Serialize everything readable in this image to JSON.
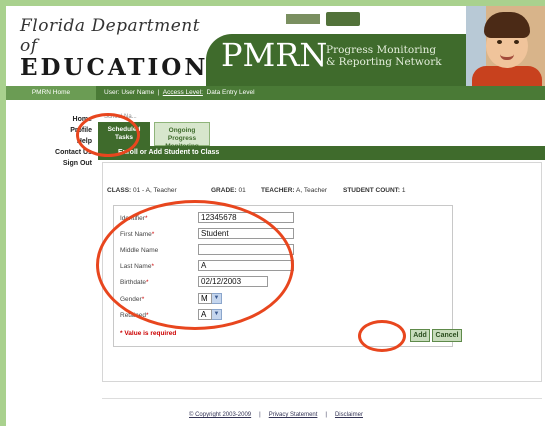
{
  "header": {
    "logo_script": "Florida Department of",
    "logo_main": "EDUCATION",
    "brand": "PMRN",
    "tagline_line1": "Progress Monitoring",
    "tagline_line2": "& Reporting Network"
  },
  "subbar": {
    "home_label": "PMRN Home",
    "user_prefix": "User:",
    "user_name": "User Name",
    "access_label": "Access Level:",
    "access_value": "Data Entry Level"
  },
  "nav": {
    "items": [
      {
        "label": "Home"
      },
      {
        "label": "Profile"
      },
      {
        "label": "Help"
      },
      {
        "label": "Contact Us"
      },
      {
        "label": "Sign Out"
      }
    ]
  },
  "main": {
    "breadcrumb": "School Na...",
    "tabs": [
      {
        "label_line1": "Scheduled",
        "label_line2": "Tasks"
      },
      {
        "label_line1": "Ongoing Progress",
        "label_line2": "Monitoring"
      }
    ],
    "section_title": "Enroll or Add Student to Class",
    "class_info": {
      "class_label": "CLASS:",
      "class_value": "01 - A, Teacher",
      "grade_label": "GRADE:",
      "grade_value": "01",
      "teacher_label": "TEACHER:",
      "teacher_value": "A, Teacher",
      "count_label": "STUDENT COUNT:",
      "count_value": "1"
    },
    "form": {
      "identifier_label": "Identifier",
      "identifier_value": "12345678",
      "first_name_label": "First Name",
      "first_name_value": "Student",
      "middle_name_label": "Middle Name",
      "middle_name_value": "",
      "last_name_label": "Last Name",
      "last_name_value": "A",
      "birthdate_label": "Birthdate",
      "birthdate_value": "02/12/2003",
      "gender_label": "Gender",
      "gender_value": "M",
      "retained_label": "Retained",
      "retained_value": "A",
      "required_marker": "*",
      "required_note": "* Value is required",
      "add_label": "Add",
      "cancel_label": "Cancel"
    }
  },
  "footer": {
    "copyright": "© Copyright 2003-2009",
    "privacy": "Privacy Statement",
    "disclaimer": "Disclaimer",
    "separator": "|"
  },
  "colors": {
    "brand_green": "#3f6b2c",
    "page_border": "#a9d18e",
    "annotation_red": "#e8461e"
  }
}
